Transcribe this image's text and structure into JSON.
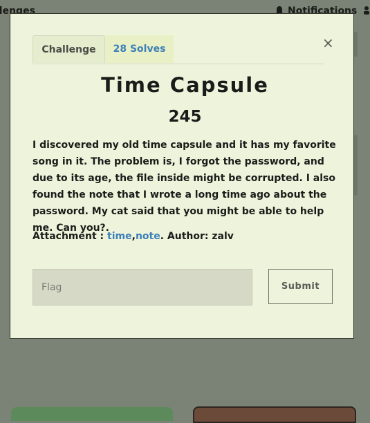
{
  "background": {
    "nav_left": "llenges",
    "nav_notifications": "Notifications",
    "nav_users_icon": "users-icon",
    "bell_icon": "bell-icon"
  },
  "modal": {
    "close_symbol": "×",
    "tabs": [
      {
        "label": "Challenge"
      },
      {
        "label": "28 Solves"
      }
    ],
    "title": "Time Capsule",
    "value": "245",
    "description": "I discovered my old time capsule and it has my favorite song in it. The problem is, I forgot the password, and due to its age, the file inside might be corrupted. I also found the note that I wrote a long time ago about the password. My cat said that you might be able to help me. Can you?.",
    "attachment": {
      "label": "Attachment : ",
      "files": [
        "time",
        "note"
      ],
      "separator": ",",
      "author": ". Author: zalv"
    },
    "flag_placeholder": "Flag",
    "submit_label": "Submit"
  },
  "colors": {
    "overlay": "#7b8377",
    "modal_bg": "#eef3dc",
    "link": "#3d7fb8"
  }
}
